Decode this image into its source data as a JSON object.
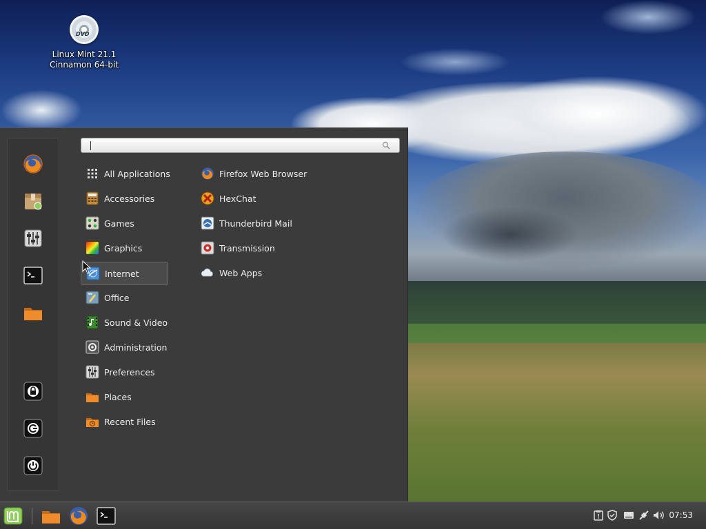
{
  "desktop": {
    "icon_name": "dvd-icon",
    "icon_text": "DVD",
    "label_line1": "Linux Mint 21.1",
    "label_line2": "Cinnamon 64-bit"
  },
  "menu": {
    "search": {
      "value": "",
      "placeholder": ""
    },
    "favorites": [
      {
        "name": "firefox-icon"
      },
      {
        "name": "software-manager-icon"
      },
      {
        "name": "system-settings-icon"
      },
      {
        "name": "terminal-icon"
      },
      {
        "name": "files-folder-icon"
      }
    ],
    "session": [
      {
        "name": "lock-screen-icon"
      },
      {
        "name": "logout-icon"
      },
      {
        "name": "shutdown-icon"
      }
    ],
    "categories": [
      {
        "label": "All Applications",
        "icon": "grid-icon"
      },
      {
        "label": "Accessories",
        "icon": "accessories-icon"
      },
      {
        "label": "Games",
        "icon": "games-icon"
      },
      {
        "label": "Graphics",
        "icon": "graphics-icon"
      },
      {
        "label": "Internet",
        "icon": "internet-icon",
        "selected": true
      },
      {
        "label": "Office",
        "icon": "office-icon"
      },
      {
        "label": "Sound & Video",
        "icon": "sound-video-icon"
      },
      {
        "label": "Administration",
        "icon": "administration-icon"
      },
      {
        "label": "Preferences",
        "icon": "preferences-icon"
      },
      {
        "label": "Places",
        "icon": "folder-icon"
      },
      {
        "label": "Recent Files",
        "icon": "recent-files-icon"
      }
    ],
    "apps": [
      {
        "label": "Firefox Web Browser",
        "icon": "firefox-icon"
      },
      {
        "label": "HexChat",
        "icon": "hexchat-icon"
      },
      {
        "label": "Thunderbird Mail",
        "icon": "thunderbird-icon"
      },
      {
        "label": "Transmission",
        "icon": "transmission-icon"
      },
      {
        "label": "Web Apps",
        "icon": "web-apps-icon"
      }
    ]
  },
  "panel": {
    "launchers": [
      "mint-menu-icon",
      "files-folder-icon",
      "firefox-icon",
      "terminal-icon"
    ],
    "tray": [
      "clipboard-icon",
      "shield-icon",
      "keyboard-icon",
      "network-icon",
      "volume-icon"
    ],
    "clock": "07:53"
  },
  "colors": {
    "menu_bg": "#3b3b3b",
    "panel_bg": "#3d3d3d",
    "mint_green": "#8fcf5c",
    "folder_orange": "#e8862a"
  }
}
